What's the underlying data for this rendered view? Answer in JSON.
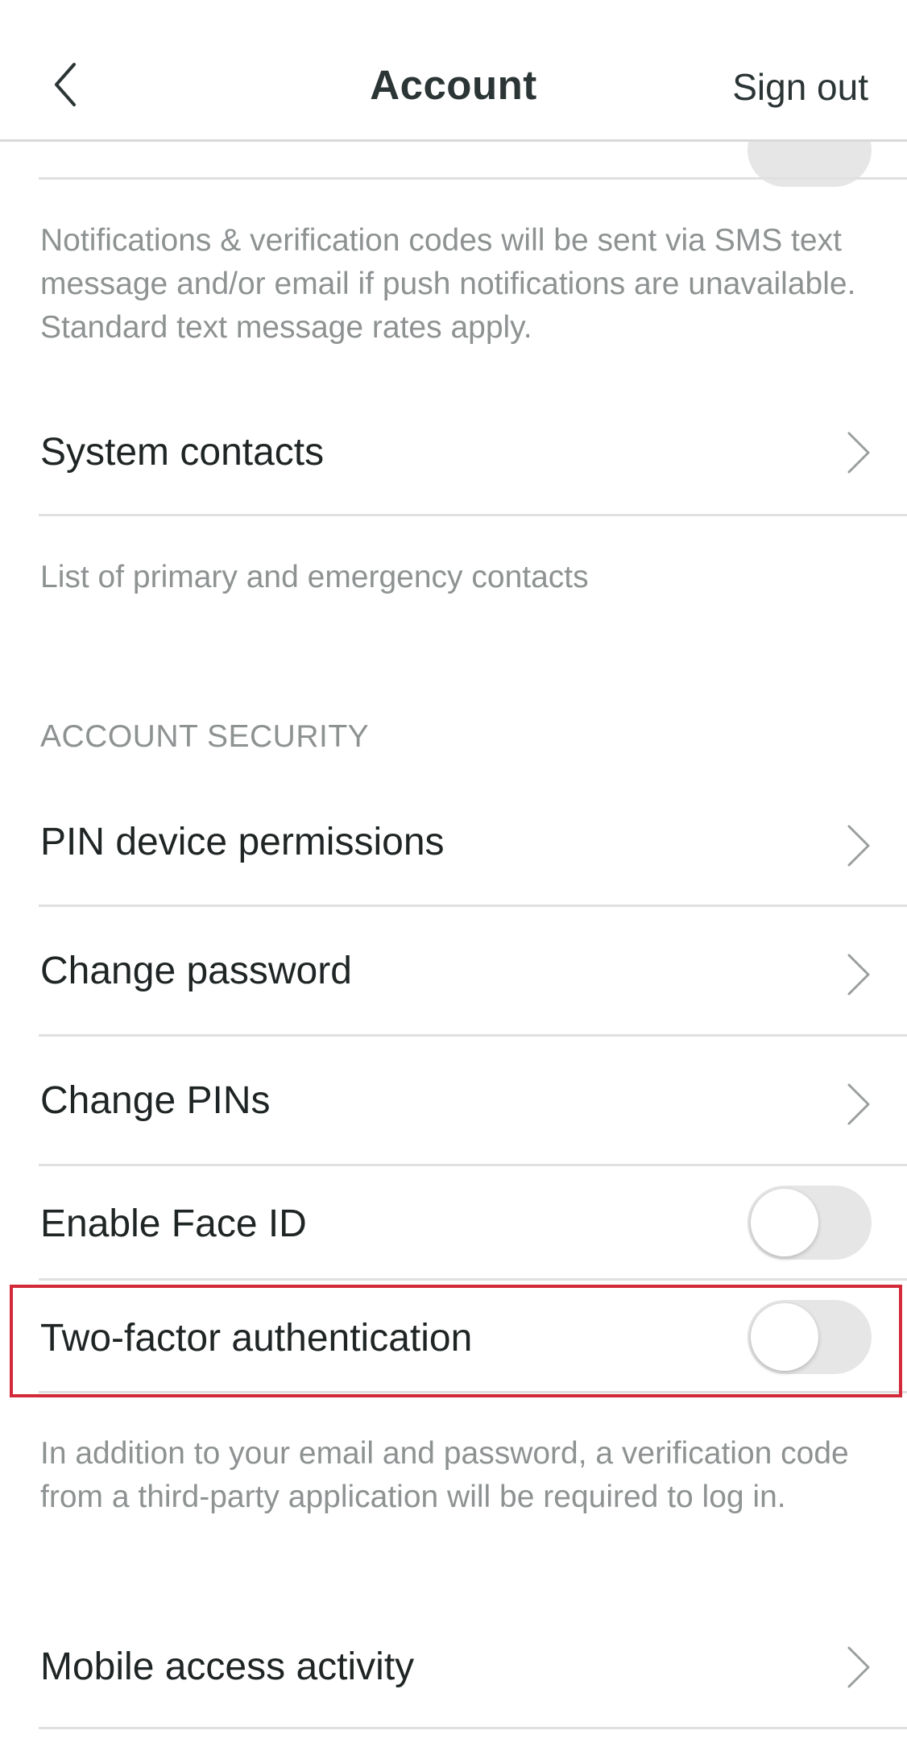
{
  "header": {
    "title": "Account",
    "sign_out_label": "Sign out"
  },
  "notifications": {
    "toggle_on": false,
    "helper_text": "Notifications & verification codes will be sent via SMS text message and/or email if push notifications are unavailable. Standard text message rates apply."
  },
  "system_contacts": {
    "label": "System contacts",
    "helper_text": "List of primary and emergency contacts"
  },
  "account_security": {
    "section_title": "ACCOUNT SECURITY",
    "items": [
      {
        "label": "PIN device permissions"
      },
      {
        "label": "Change password"
      },
      {
        "label": "Change PINs"
      }
    ],
    "face_id": {
      "label": "Enable Face ID",
      "toggle_on": false
    },
    "two_factor": {
      "label": "Two-factor authentication",
      "toggle_on": false,
      "highlighted": true,
      "helper_text": "In addition to your email and password, a verification code from a third-party application will be required to log in."
    },
    "mobile_access": {
      "label": "Mobile access activity"
    }
  },
  "colors": {
    "highlight": "#d32a3a",
    "toggle_off": "#e6e6e6",
    "helper_text": "#8e9292",
    "title_text": "#2c3535"
  },
  "icons": {
    "back": "chevron-left-icon",
    "row_arrow": "chevron-right-icon"
  }
}
